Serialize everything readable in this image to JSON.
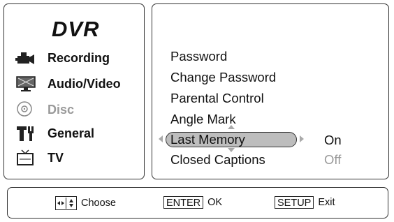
{
  "sidebar": {
    "title": "DVR",
    "items": [
      {
        "label": "Recording",
        "icon": "camcorder-icon",
        "enabled": true
      },
      {
        "label": "Audio/Video",
        "icon": "tv-screen-icon",
        "enabled": true
      },
      {
        "label": "Disc",
        "icon": "disc-icon",
        "enabled": false
      },
      {
        "label": "General",
        "icon": "tools-icon",
        "enabled": true
      },
      {
        "label": "TV",
        "icon": "tv-icon",
        "enabled": true
      }
    ]
  },
  "menu": {
    "items": [
      {
        "label": "Password"
      },
      {
        "label": "Change Password"
      },
      {
        "label": "Parental Control"
      },
      {
        "label": "Angle Mark"
      },
      {
        "label": "Last Memory",
        "value": "On",
        "selected": true
      },
      {
        "label": "Closed Captions",
        "value": "Off"
      }
    ]
  },
  "footer": {
    "choose_label": "Choose",
    "enter_key": "ENTER",
    "enter_label": "OK",
    "setup_key": "SETUP",
    "setup_label": "Exit"
  },
  "colors": {
    "highlight": "#bdbdbd",
    "disabled_text": "#9a9a9a",
    "border": "#333333"
  }
}
